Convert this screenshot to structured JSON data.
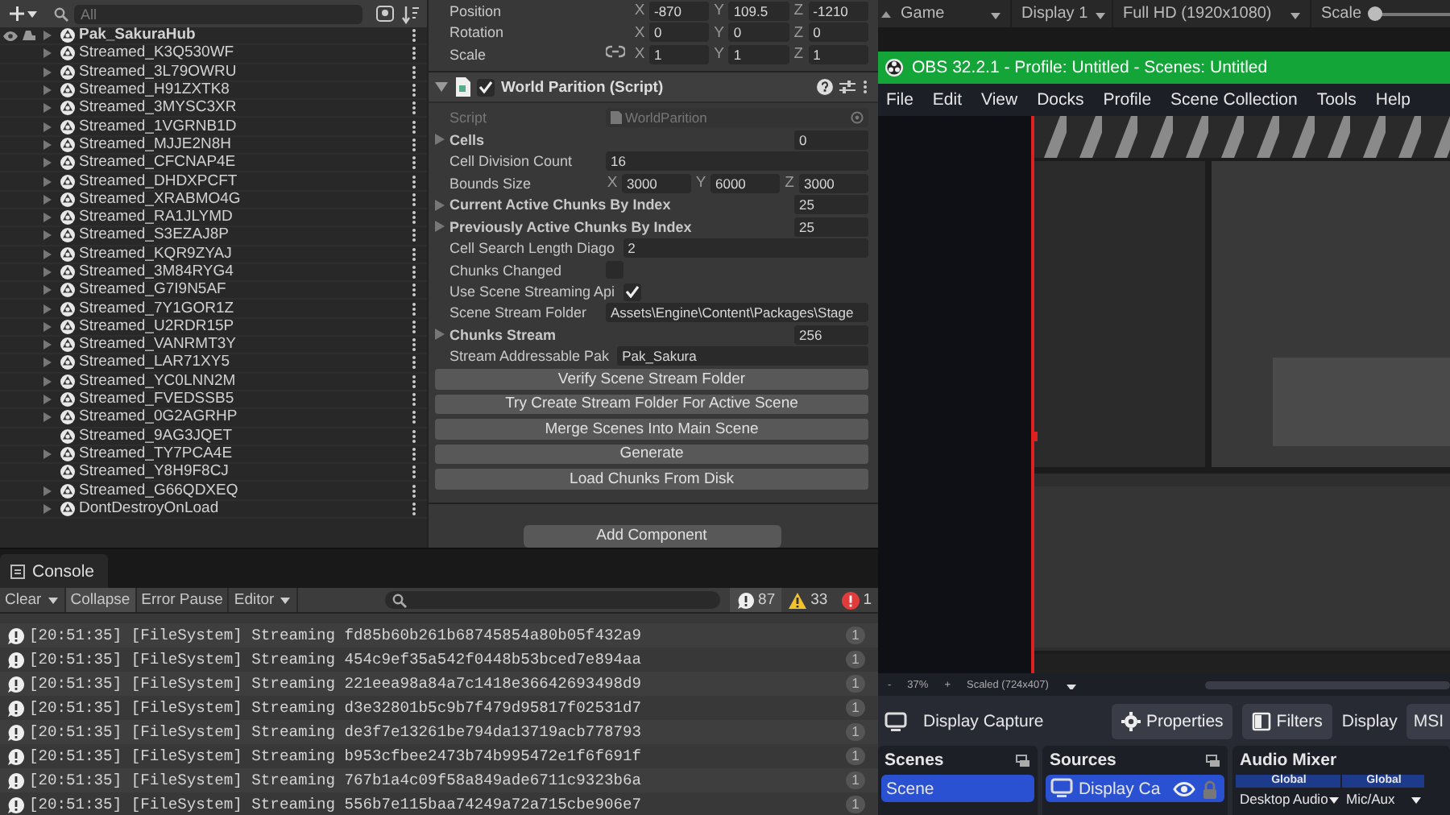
{
  "hierarchy": {
    "search": {
      "placeholder": "All"
    },
    "items": [
      {
        "name": "Pak_SakuraHub",
        "kind": "scene",
        "expandable": true
      },
      {
        "name": "Streamed_K3Q530WF",
        "kind": "object",
        "expandable": true
      },
      {
        "name": "Streamed_3L79OWRU",
        "kind": "object",
        "expandable": true
      },
      {
        "name": "Streamed_H91ZXTK8",
        "kind": "object",
        "expandable": true
      },
      {
        "name": "Streamed_3MYSC3XR",
        "kind": "object",
        "expandable": true
      },
      {
        "name": "Streamed_1VGRNB1D",
        "kind": "object",
        "expandable": true
      },
      {
        "name": "Streamed_MJJE2N8H",
        "kind": "object",
        "expandable": true
      },
      {
        "name": "Streamed_CFCNAP4E",
        "kind": "object",
        "expandable": true
      },
      {
        "name": "Streamed_DHDXPCFT",
        "kind": "object",
        "expandable": true
      },
      {
        "name": "Streamed_XRABMO4G",
        "kind": "object",
        "expandable": true
      },
      {
        "name": "Streamed_RA1JLYMD",
        "kind": "object",
        "expandable": true
      },
      {
        "name": "Streamed_S3EZAJ8P",
        "kind": "object",
        "expandable": true
      },
      {
        "name": "Streamed_KQR9ZYAJ",
        "kind": "object",
        "expandable": true
      },
      {
        "name": "Streamed_3M84RYG4",
        "kind": "object",
        "expandable": true
      },
      {
        "name": "Streamed_G7I9N5AF",
        "kind": "object",
        "expandable": true
      },
      {
        "name": "Streamed_7Y1GOR1Z",
        "kind": "object",
        "expandable": true
      },
      {
        "name": "Streamed_U2RDR15P",
        "kind": "object",
        "expandable": true
      },
      {
        "name": "Streamed_VANRMT3Y",
        "kind": "object",
        "expandable": true
      },
      {
        "name": "Streamed_LAR71XY5",
        "kind": "object",
        "expandable": true
      },
      {
        "name": "Streamed_YC0LNN2M",
        "kind": "object",
        "expandable": true
      },
      {
        "name": "Streamed_FVEDSSB5",
        "kind": "object",
        "expandable": true
      },
      {
        "name": "Streamed_0G2AGRHP",
        "kind": "object",
        "expandable": true
      },
      {
        "name": "Streamed_9AG3JQET",
        "kind": "object",
        "expandable": false
      },
      {
        "name": "Streamed_TY7PCA4E",
        "kind": "object",
        "expandable": true
      },
      {
        "name": "Streamed_Y8H9F8CJ",
        "kind": "object",
        "expandable": false
      },
      {
        "name": "Streamed_G66QDXEQ",
        "kind": "object",
        "expandable": true
      },
      {
        "name": "DontDestroyOnLoad",
        "kind": "object",
        "expandable": true
      }
    ]
  },
  "inspector": {
    "transform": [
      {
        "label": "Position",
        "linked": false,
        "values": [
          {
            "axis": "X",
            "value": "-870"
          },
          {
            "axis": "Y",
            "value": "109.5"
          },
          {
            "axis": "Z",
            "value": "-1210"
          }
        ]
      },
      {
        "label": "Rotation",
        "linked": false,
        "values": [
          {
            "axis": "X",
            "value": "0"
          },
          {
            "axis": "Y",
            "value": "0"
          },
          {
            "axis": "Z",
            "value": "0"
          }
        ]
      },
      {
        "label": "Scale",
        "linked": true,
        "values": [
          {
            "axis": "X",
            "value": "1"
          },
          {
            "axis": "Y",
            "value": "1"
          },
          {
            "axis": "Z",
            "value": "1"
          }
        ]
      }
    ],
    "component": {
      "title": "World Parition (Script)",
      "enabled": true,
      "expanded": true,
      "fields": [
        {
          "kind": "object",
          "label": "Script",
          "value": "WorldParition",
          "disabled": true
        },
        {
          "kind": "list",
          "label": "Cells",
          "value": "0"
        },
        {
          "kind": "text",
          "label": "Cell Division Count",
          "value": "16"
        },
        {
          "kind": "vector",
          "label": "Bounds Size",
          "values": [
            {
              "axis": "X",
              "value": "3000"
            },
            {
              "axis": "Y",
              "value": "6000"
            },
            {
              "axis": "Z",
              "value": "3000"
            }
          ]
        },
        {
          "kind": "list",
          "label": "Current Active Chunks By Index",
          "value": "25"
        },
        {
          "kind": "list",
          "label": "Previously Active Chunks By Index",
          "value": "25"
        },
        {
          "kind": "text",
          "label": "Cell Search Length Diago",
          "value": "2"
        },
        {
          "kind": "toggle",
          "label": "Chunks Changed",
          "checked": false
        },
        {
          "kind": "toggle",
          "label": "Use Scene Streaming Api",
          "checked": true
        },
        {
          "kind": "text",
          "label": "Scene Stream Folder",
          "value": "Assets\\Engine\\Content\\Packages\\Stage"
        },
        {
          "kind": "list",
          "label": "Chunks Stream",
          "value": "256"
        },
        {
          "kind": "text",
          "label": "Stream Addressable Pak",
          "value": "Pak_Sakura"
        }
      ],
      "buttons": [
        "Verify Scene Stream Folder",
        "Try Create Stream Folder For Active Scene",
        "Merge Scenes Into Main Scene",
        "Generate",
        "Load Chunks From Disk"
      ]
    },
    "add_component": "Add Component"
  },
  "console": {
    "tab": "Console",
    "toolbar": [
      {
        "label": "Clear",
        "kind": "dropdown",
        "selected": false
      },
      {
        "label": "Collapse",
        "kind": "toggle",
        "selected": true
      },
      {
        "label": "Error Pause",
        "kind": "toggle",
        "selected": false
      },
      {
        "label": "Editor",
        "kind": "dropdown",
        "selected": false
      }
    ],
    "counts": [
      {
        "kind": "info",
        "count": "87"
      },
      {
        "kind": "warning",
        "count": "33"
      },
      {
        "kind": "error",
        "count": "1"
      }
    ],
    "entries": [
      {
        "message": "[20:51:35] [FileSystem] Streaming fd85b60b261b68745854a80b05f432a9",
        "count": "1"
      },
      {
        "message": "[20:51:35] [FileSystem] Streaming 454c9ef35a542f0448b53bced7e894aa",
        "count": "1"
      },
      {
        "message": "[20:51:35] [FileSystem] Streaming 221eea98a84a7c1418e36642693498d9",
        "count": "1"
      },
      {
        "message": "[20:51:35] [FileSystem] Streaming d3e32801b5c9b7f479d95817f02531d7",
        "count": "1"
      },
      {
        "message": "[20:51:35] [FileSystem] Streaming de3f7e13261be794da13719acb778793",
        "count": "1"
      },
      {
        "message": "[20:51:35] [FileSystem] Streaming b953cfbee2473b74b995472e1f6f691f",
        "count": "1"
      },
      {
        "message": "[20:51:35] [FileSystem] Streaming 767b1a4c09f58a849ade6711c9323b6a",
        "count": "1"
      },
      {
        "message": "[20:51:35] [FileSystem] Streaming 556b7e115baa74249a72a715cbe906e7",
        "count": "1"
      }
    ]
  },
  "game_view": {
    "tab": "Game",
    "display": "Display 1",
    "resolution": "Full HD (1920x1080)",
    "scale_label": "Scale",
    "level": 0
  },
  "obs": {
    "title": "OBS 32.2.1 - Profile: Untitled - Scenes: Untitled",
    "menu": [
      "File",
      "Edit",
      "View",
      "Docks",
      "Profile",
      "Scene Collection",
      "Tools",
      "Help"
    ],
    "zoom": {
      "minus": "-",
      "percent": "37%",
      "plus": "+",
      "mode": "Scaled (724x407)"
    },
    "source_bar": {
      "source": "Display Capture",
      "properties": "Properties",
      "filters": "Filters",
      "label": "Display",
      "value": "MSI"
    },
    "scenes": {
      "title": "Scenes",
      "items": [
        {
          "name": "Scene",
          "selected": true
        }
      ]
    },
    "sources": {
      "title": "Sources",
      "items": [
        {
          "name": "Display Ca",
          "selected": true,
          "visible": true,
          "locked": false
        }
      ]
    },
    "audio_mixer": {
      "title": "Audio Mixer",
      "channels": [
        {
          "scope": "Global",
          "name": "Desktop Audio"
        },
        {
          "scope": "Global",
          "name": "Mic/Aux"
        }
      ]
    }
  }
}
